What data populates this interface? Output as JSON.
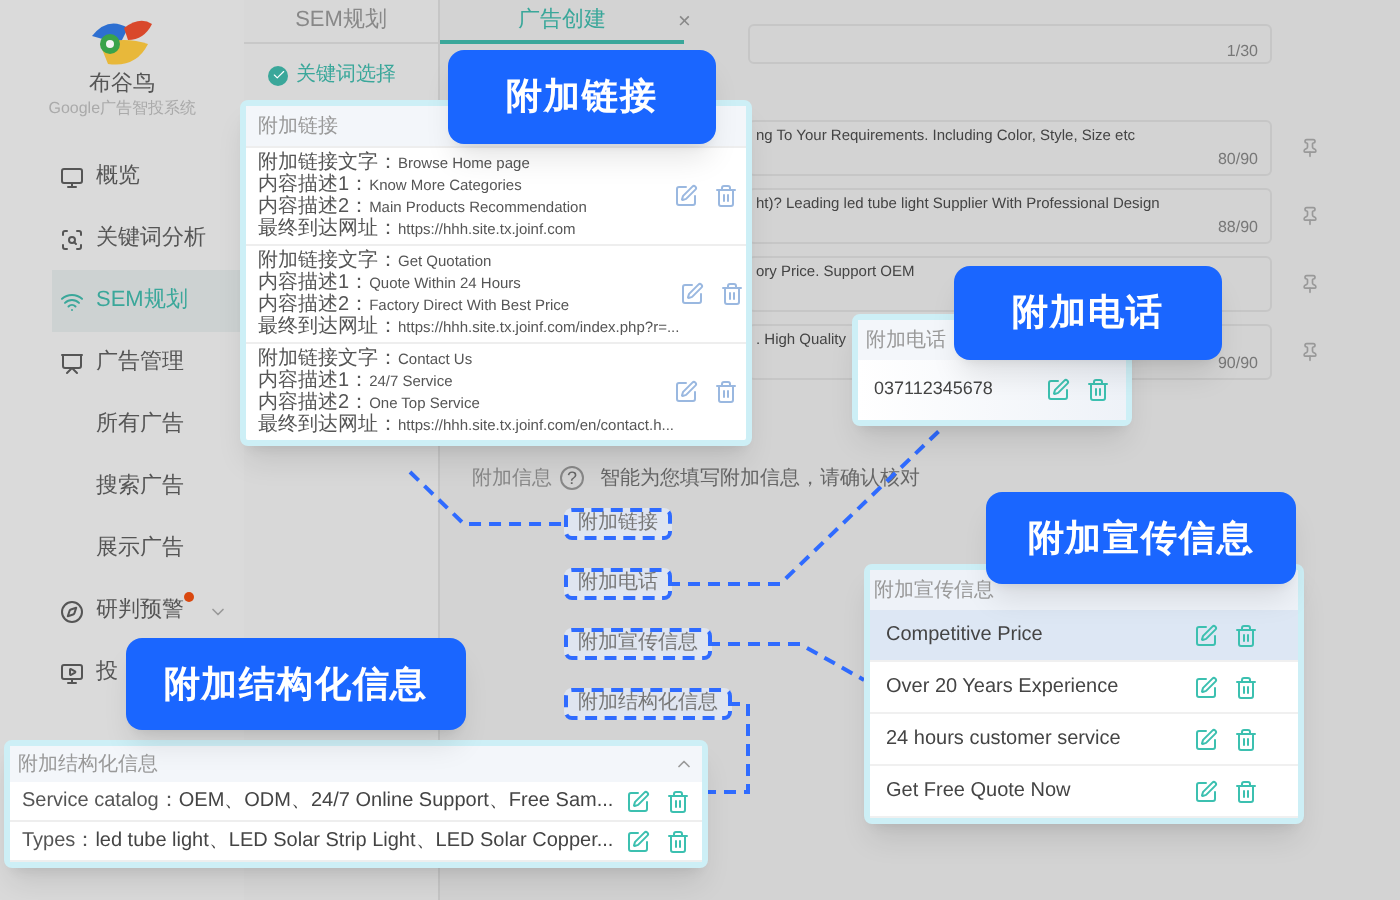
{
  "sidebar": {
    "brand": "布谷鸟",
    "subtitle": "Google广告智投系统",
    "items": [
      {
        "label": "概览",
        "selected": false
      },
      {
        "label": "关键词分析",
        "selected": false
      },
      {
        "label": "SEM规划",
        "selected": true
      },
      {
        "label": "广告管理",
        "selected": false,
        "children": [
          {
            "label": "所有广告",
            "selected": false
          },
          {
            "label": "搜索广告",
            "selected": false
          },
          {
            "label": "展示广告",
            "selected": false
          }
        ]
      },
      {
        "label": "研判预警",
        "selected": false,
        "alert": true,
        "expanded": false
      },
      {
        "label": "投",
        "selected": false
      }
    ]
  },
  "steps_panel": {
    "title": "SEM规划",
    "steps": [
      {
        "label": "关键词选择",
        "done": true
      }
    ]
  },
  "editor": {
    "tab": {
      "label": "广告创建",
      "close": "×",
      "selected": true
    },
    "fields": [
      {
        "counter": "1/30"
      },
      {
        "text": "ng To Your Requirements. Including Color, Style, Size etc",
        "counter": "80/90"
      },
      {
        "text": "ht)? Leading led tube light Supplier With Professional Design",
        "counter": "88/90"
      },
      {
        "text": "ory Price. Support OEM"
      },
      {
        "text": ". High Quality",
        "counter": "90/90"
      }
    ],
    "info": {
      "label": "附加信息",
      "help": "?",
      "hint": "智能为您填写附加信息，请确认核对"
    },
    "buttons": [
      "附加链接",
      "附加电话",
      "附加宣传信息",
      "附加结构化信息"
    ]
  },
  "sitelinks": {
    "callout": "附加链接",
    "title": "附加链接",
    "items": [
      {
        "lines": [
          {
            "label": "附加链接文字：",
            "value": "Browse Home page"
          },
          {
            "label": "内容描述1：",
            "value": "Know More Categories"
          },
          {
            "label": "内容描述2：",
            "value": "Main Products Recommendation"
          },
          {
            "label": "最终到达网址：",
            "value": "https://hhh.site.tx.joinf.com"
          }
        ]
      },
      {
        "lines": [
          {
            "label": "附加链接文字：",
            "value": "Get Quotation"
          },
          {
            "label": "内容描述1：",
            "value": "Quote Within 24 Hours"
          },
          {
            "label": "内容描述2：",
            "value": "Factory Direct With Best Price"
          },
          {
            "label": "最终到达网址：",
            "value": "https://hhh.site.tx.joinf.com/index.php?r=..."
          }
        ]
      },
      {
        "lines": [
          {
            "label": "附加链接文字：",
            "value": "Contact Us"
          },
          {
            "label": "内容描述1：",
            "value": "24/7 Service"
          },
          {
            "label": "内容描述2：",
            "value": "One Top Service"
          },
          {
            "label": "最终到达网址：",
            "value": "https://hhh.site.tx.joinf.com/en/contact.h..."
          }
        ]
      }
    ]
  },
  "phone": {
    "callout": "附加电话",
    "title": "附加电话",
    "value": "037112345678"
  },
  "promotions": {
    "callout": "附加宣传信息",
    "title": "附加宣传信息",
    "items": [
      {
        "text": "Competitive Price",
        "selected": true
      },
      {
        "text": "Over 20 Years Experience",
        "selected": false
      },
      {
        "text": "24 hours customer service",
        "selected": false
      },
      {
        "text": "Get Free Quote Now",
        "selected": false
      }
    ]
  },
  "structured": {
    "callout": "附加结构化信息",
    "title": "附加结构化信息",
    "expanded": true,
    "items": [
      {
        "label": "Service catalog：",
        "value": "OEM、ODM、24/7 Online Support、Free Sam..."
      },
      {
        "label": "Types：",
        "value": "led tube light、LED Solar Strip Light、LED Solar Copper..."
      }
    ]
  }
}
